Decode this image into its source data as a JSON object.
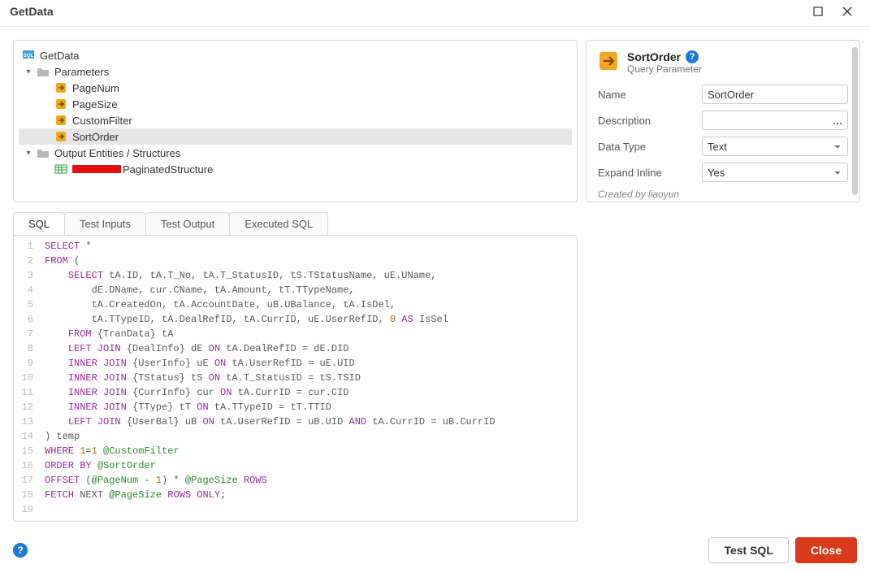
{
  "window": {
    "title": "GetData"
  },
  "tree": {
    "root": "GetData",
    "parameters": "Parameters",
    "params": [
      "PageNum",
      "PageSize",
      "CustomFilter",
      "SortOrder"
    ],
    "output_label": "Output Entities / Structures",
    "output_item": "PaginatedStructure"
  },
  "tabs": [
    "SQL",
    "Test Inputs",
    "Test Output",
    "Executed SQL"
  ],
  "code": {
    "lines": [
      {
        "n": 1,
        "t": [
          {
            "c": "kw",
            "v": "SELECT"
          },
          {
            "c": "",
            "v": " *"
          }
        ]
      },
      {
        "n": 2,
        "t": [
          {
            "c": "kw",
            "v": "FROM"
          },
          {
            "c": "",
            "v": " ("
          }
        ]
      },
      {
        "n": 3,
        "indent": 1,
        "t": [
          {
            "c": "kw",
            "v": "SELECT"
          },
          {
            "c": "",
            "v": " tA.ID, tA.T_No, tA.T_StatusID, tS.TStatusName, uE.UName,"
          }
        ]
      },
      {
        "n": 4,
        "indent": 2,
        "t": [
          {
            "c": "",
            "v": "dE.DName, cur.CName, tA.Amount, tT.TTypeName,"
          }
        ]
      },
      {
        "n": 5,
        "indent": 2,
        "t": [
          {
            "c": "",
            "v": "tA.CreatedOn, tA.AccountDate, uB.UBalance, tA.IsDel,"
          }
        ]
      },
      {
        "n": 6,
        "indent": 2,
        "t": [
          {
            "c": "",
            "v": "tA.TTypeID, tA.DealRefID, tA.CurrID, uE.UserRefID, "
          },
          {
            "c": "num",
            "v": "0"
          },
          {
            "c": "",
            "v": " "
          },
          {
            "c": "kw",
            "v": "AS"
          },
          {
            "c": "",
            "v": " IsSel"
          }
        ]
      },
      {
        "n": 7,
        "indent": 1,
        "t": [
          {
            "c": "kw",
            "v": "FROM"
          },
          {
            "c": "",
            "v": " {TranData} tA"
          }
        ]
      },
      {
        "n": 8,
        "indent": 1,
        "t": [
          {
            "c": "kw",
            "v": "LEFT JOIN"
          },
          {
            "c": "",
            "v": " {DealInfo} dE "
          },
          {
            "c": "kw",
            "v": "ON"
          },
          {
            "c": "",
            "v": " tA.DealRefID = dE.DID"
          }
        ]
      },
      {
        "n": 9,
        "indent": 1,
        "t": [
          {
            "c": "kw",
            "v": "INNER JOIN"
          },
          {
            "c": "",
            "v": " {UserInfo} uE "
          },
          {
            "c": "kw",
            "v": "ON"
          },
          {
            "c": "",
            "v": " tA.UserRefID = uE.UID"
          }
        ]
      },
      {
        "n": 10,
        "indent": 1,
        "t": [
          {
            "c": "kw",
            "v": "INNER JOIN"
          },
          {
            "c": "",
            "v": " {TStatus} tS "
          },
          {
            "c": "kw",
            "v": "ON"
          },
          {
            "c": "",
            "v": " tA.T_StatusID = tS.TSID"
          }
        ]
      },
      {
        "n": 11,
        "indent": 1,
        "t": [
          {
            "c": "kw",
            "v": "INNER JOIN"
          },
          {
            "c": "",
            "v": " {CurrInfo} cur "
          },
          {
            "c": "kw",
            "v": "ON"
          },
          {
            "c": "",
            "v": " tA.CurrID = cur.CID"
          }
        ]
      },
      {
        "n": 12,
        "indent": 1,
        "t": [
          {
            "c": "kw",
            "v": "INNER JOIN"
          },
          {
            "c": "",
            "v": " {TType} tT "
          },
          {
            "c": "kw",
            "v": "ON"
          },
          {
            "c": "",
            "v": " tA.TTypeID = tT.TTID"
          }
        ]
      },
      {
        "n": 13,
        "indent": 1,
        "t": [
          {
            "c": "kw",
            "v": "LEFT JOIN"
          },
          {
            "c": "",
            "v": " {UserBal} uB "
          },
          {
            "c": "kw",
            "v": "ON"
          },
          {
            "c": "",
            "v": " tA.UserRefID = uB.UID "
          },
          {
            "c": "kw",
            "v": "AND"
          },
          {
            "c": "",
            "v": " tA.CurrID = uB.CurrID"
          }
        ]
      },
      {
        "n": 14,
        "t": [
          {
            "c": "",
            "v": ") temp"
          }
        ]
      },
      {
        "n": 15,
        "t": [
          {
            "c": "kw",
            "v": "WHERE"
          },
          {
            "c": "",
            "v": " "
          },
          {
            "c": "num",
            "v": "1"
          },
          {
            "c": "",
            "v": "="
          },
          {
            "c": "num",
            "v": "1"
          },
          {
            "c": "",
            "v": " "
          },
          {
            "c": "param",
            "v": "@CustomFilter"
          }
        ]
      },
      {
        "n": 16,
        "t": [
          {
            "c": "kw",
            "v": "ORDER BY"
          },
          {
            "c": "",
            "v": " "
          },
          {
            "c": "param",
            "v": "@SortOrder"
          }
        ]
      },
      {
        "n": 17,
        "t": [
          {
            "c": "kw",
            "v": "OFFSET"
          },
          {
            "c": "",
            "v": " ("
          },
          {
            "c": "param",
            "v": "@PageNum"
          },
          {
            "c": "",
            "v": " - "
          },
          {
            "c": "num",
            "v": "1"
          },
          {
            "c": "",
            "v": ") * "
          },
          {
            "c": "param",
            "v": "@PageSize"
          },
          {
            "c": "",
            "v": " "
          },
          {
            "c": "kw",
            "v": "ROWS"
          }
        ]
      },
      {
        "n": 18,
        "t": [
          {
            "c": "kw",
            "v": "FETCH"
          },
          {
            "c": "",
            "v": " NEXT "
          },
          {
            "c": "param",
            "v": "@PageSize"
          },
          {
            "c": "",
            "v": " "
          },
          {
            "c": "kw",
            "v": "ROWS ONLY"
          },
          {
            "c": "",
            "v": ";"
          }
        ]
      },
      {
        "n": 19,
        "t": [
          {
            "c": "",
            "v": ""
          }
        ]
      }
    ]
  },
  "panel": {
    "title": "SortOrder",
    "subtitle": "Query Parameter",
    "props": {
      "name_label": "Name",
      "name_value": "SortOrder",
      "desc_label": "Description",
      "desc_value": "",
      "type_label": "Data Type",
      "type_value": "Text",
      "expand_label": "Expand Inline",
      "expand_value": "Yes"
    },
    "created": "Created by liaoyun"
  },
  "footer": {
    "test": "Test SQL",
    "close": "Close"
  }
}
